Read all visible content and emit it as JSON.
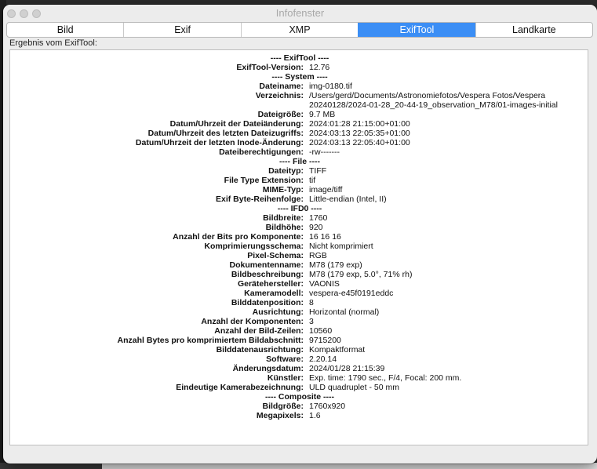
{
  "window": {
    "title": "Infofenster"
  },
  "tabs": [
    "Bild",
    "Exif",
    "XMP",
    "ExifTool",
    "Landkarte"
  ],
  "active_tab": "ExifTool",
  "result_label": "Ergebnis vom ExifTool:",
  "rows": [
    {
      "type": "section",
      "text": "---- ExifTool ----"
    },
    {
      "k": "ExifTool-Version:",
      "v": "12.76"
    },
    {
      "type": "section",
      "text": "---- System ----"
    },
    {
      "k": "Dateiname:",
      "v": "img-0180.tif"
    },
    {
      "k": "Verzeichnis:",
      "v": "/Users/gerd/Documents/Astronomiefotos/Vespera Fotos/Vespera"
    },
    {
      "k": "",
      "v": "20240128/2024-01-28_20-44-19_observation_M78/01-images-initial"
    },
    {
      "k": "Dateigröße:",
      "v": "9.7 MB"
    },
    {
      "k": "Datum/Uhrzeit der Dateiänderung:",
      "v": "2024:01:28 21:15:00+01:00"
    },
    {
      "k": "Datum/Uhrzeit des letzten Dateizugriffs:",
      "v": "2024:03:13 22:05:35+01:00"
    },
    {
      "k": "Datum/Uhrzeit der letzten Inode-Änderung:",
      "v": "2024:03:13 22:05:40+01:00"
    },
    {
      "k": "Dateiberechtigungen:",
      "v": "-rw-------"
    },
    {
      "type": "section",
      "text": "---- File ----"
    },
    {
      "k": "Dateityp:",
      "v": "TIFF"
    },
    {
      "k": "File Type Extension:",
      "v": "tif"
    },
    {
      "k": "MIME-Typ:",
      "v": "image/tiff"
    },
    {
      "k": "Exif Byte-Reihenfolge:",
      "v": "Little-endian (Intel, II)"
    },
    {
      "type": "section",
      "text": "---- IFD0 ----"
    },
    {
      "k": "Bildbreite:",
      "v": "1760"
    },
    {
      "k": "Bildhöhe:",
      "v": "920"
    },
    {
      "k": "Anzahl der Bits pro Komponente:",
      "v": "16 16 16"
    },
    {
      "k": "Komprimierungsschema:",
      "v": "Nicht komprimiert"
    },
    {
      "k": "Pixel-Schema:",
      "v": "RGB"
    },
    {
      "k": "Dokumentenname:",
      "v": "M78 (179 exp)"
    },
    {
      "k": "Bildbeschreibung:",
      "v": "M78 (179 exp, 5.0°, 71% rh)"
    },
    {
      "k": "Gerätehersteller:",
      "v": "VAONIS"
    },
    {
      "k": "Kameramodell:",
      "v": "vespera-e45f0191eddc"
    },
    {
      "k": "Bilddatenposition:",
      "v": "8"
    },
    {
      "k": "Ausrichtung:",
      "v": "Horizontal (normal)"
    },
    {
      "k": "Anzahl der Komponenten:",
      "v": "3"
    },
    {
      "k": "Anzahl der Bild-Zeilen:",
      "v": "10560"
    },
    {
      "k": "Anzahl Bytes pro komprimiertem Bildabschnitt:",
      "v": "9715200"
    },
    {
      "k": "Bilddatenausrichtung:",
      "v": "Kompaktformat"
    },
    {
      "k": "Software:",
      "v": "2.20.14"
    },
    {
      "k": "Änderungsdatum:",
      "v": "2024/01/28 21:15:39"
    },
    {
      "k": "Künstler:",
      "v": "Exp. time: 1790 sec., F/4, Focal: 200 mm."
    },
    {
      "k": "Eindeutige Kamerabezeichnung:",
      "v": "ULD quadruplet - 50 mm"
    },
    {
      "type": "section",
      "text": "---- Composite ----"
    },
    {
      "k": "Bildgröße:",
      "v": "1760x920"
    },
    {
      "k": "Megapixels:",
      "v": "1.6"
    }
  ]
}
